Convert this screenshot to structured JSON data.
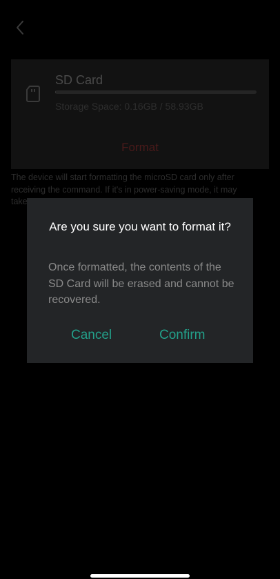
{
  "nav": {
    "back_icon": "chevron-left-icon"
  },
  "card": {
    "icon": "sd-card-icon",
    "title": "SD Card",
    "storage_text": "Storage Space: 0.16GB / 58.93GB",
    "storage_used_fraction": 0.003,
    "format_label": "Format"
  },
  "note": "The device will start formatting the microSD card only after\nreceiving the command. If it's in power-saving mode, it may\ntake",
  "dialog": {
    "title": "Are you sure you want to format it?",
    "message": "Once formatted, the contents of the SD Card will be erased and cannot be recovered.",
    "cancel_label": "Cancel",
    "confirm_label": "Confirm"
  },
  "colors": {
    "accent": "#23A08A",
    "format_red": "#4A1A1A",
    "dialog_bg": "#232527"
  }
}
